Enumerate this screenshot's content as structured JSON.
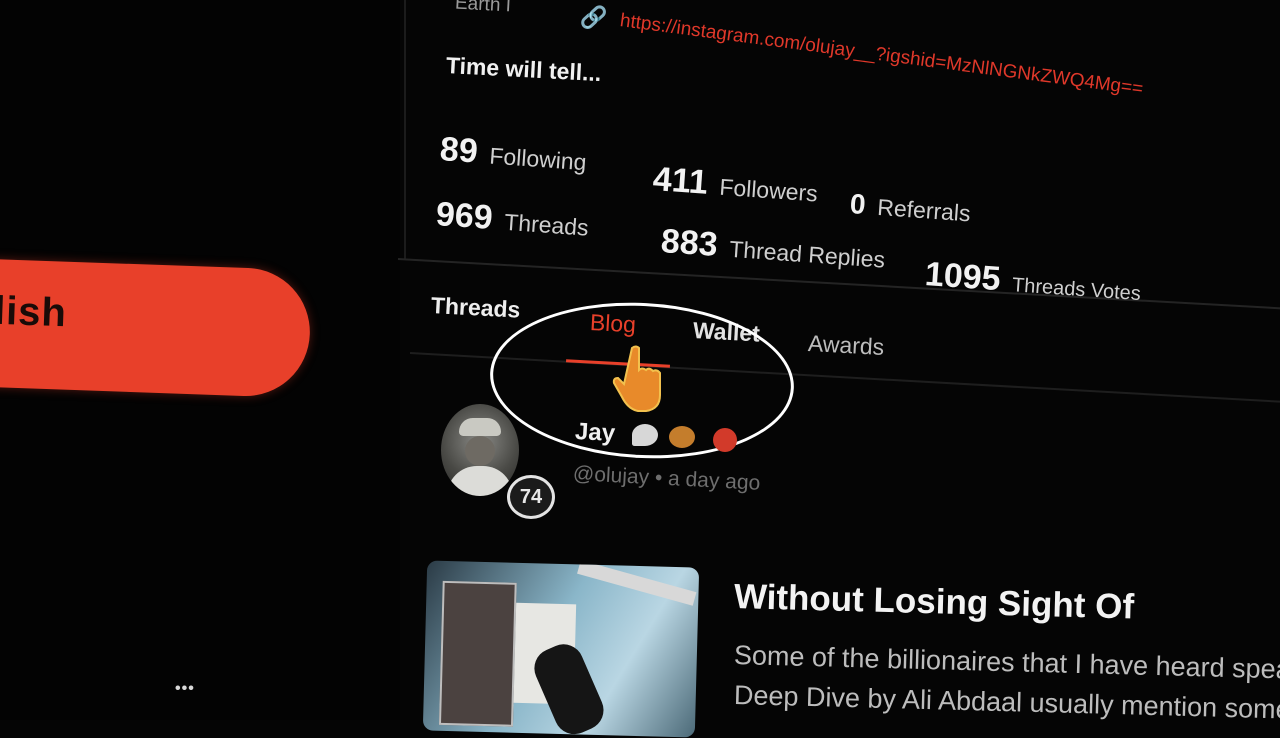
{
  "sidebar": {
    "publish_label": "lish",
    "more_dots": "•••"
  },
  "profile": {
    "location": "Earth I",
    "link": "https://instagram.com/olujay__?igshid=MzNlNGNkZWQ4Mg==",
    "bio": "Time will tell...",
    "stats": [
      {
        "value": "89",
        "label": "Following"
      },
      {
        "value": "411",
        "label": "Followers"
      },
      {
        "value": "0",
        "label": "Referrals"
      },
      {
        "value": "969",
        "label": "Threads"
      },
      {
        "value": "883",
        "label": "Thread Replies"
      },
      {
        "value": "1095",
        "label": "Threads Votes"
      }
    ]
  },
  "tabs": [
    {
      "label": "Threads",
      "active": false
    },
    {
      "label": "Blog",
      "active": true
    },
    {
      "label": "Wallet",
      "active": false
    },
    {
      "label": "Awards",
      "active": false
    }
  ],
  "post": {
    "author": "Jay",
    "handle": "@olujay",
    "time": "a day ago",
    "level": "74",
    "title": "Without Losing Sight Of",
    "excerpt_line1": "Some of the billionaires that I have heard speak",
    "excerpt_line2": "Deep Dive by Ali Abdaal usually mention someth"
  },
  "colors": {
    "accent": "#e8402a",
    "background": "#050505",
    "text": "#e9e9e9",
    "muted": "#6e6e6e"
  },
  "icons": {
    "link": "link-icon",
    "cursor": "pointer-hand-icon",
    "badge_chat": "chat-bubble-icon",
    "badge_heart": "heart-badge-icon",
    "badge_red": "red-badge-icon"
  }
}
